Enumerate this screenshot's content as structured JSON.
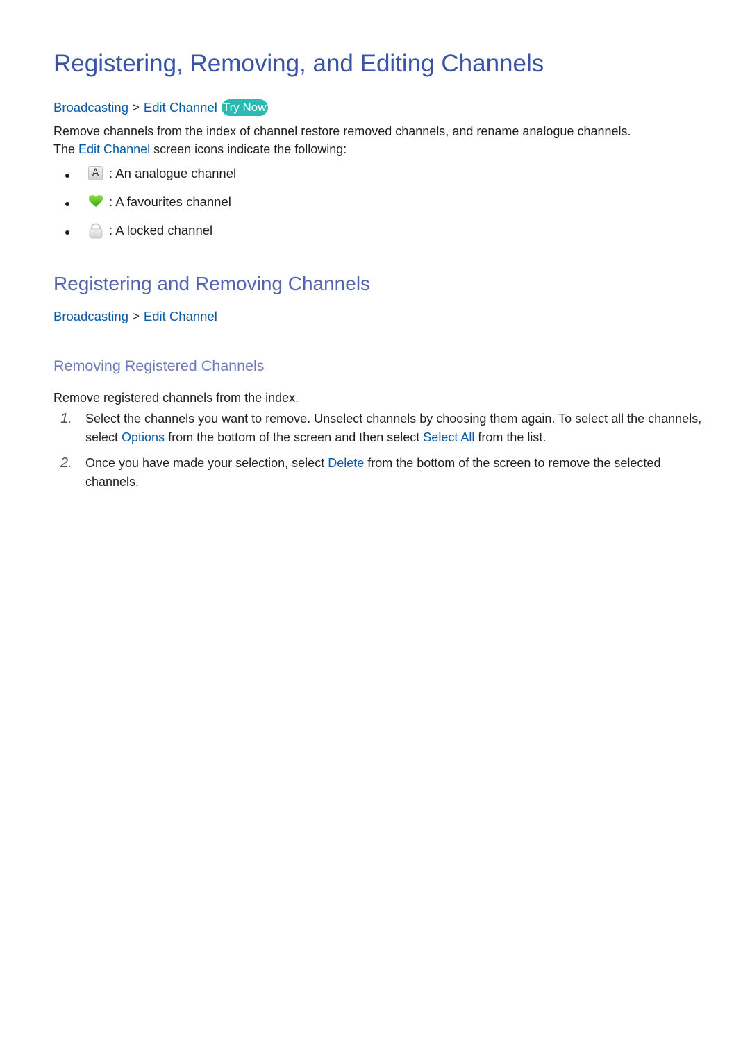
{
  "title": "Registering, Removing, and Editing Channels",
  "breadcrumb_1": {
    "items": [
      "Broadcasting",
      "Edit Channel"
    ],
    "separator": ">",
    "try_now": "Try Now"
  },
  "intro": {
    "line1": "Remove channels from the index of channel restore removed channels, and rename analogue channels.",
    "line2_prefix": "The ",
    "line2_link": "Edit Channel",
    "line2_suffix": " screen icons indicate the following:"
  },
  "icon_legend": [
    {
      "icon": "analogue-icon",
      "glyph": "A",
      "text": ": An analogue channel"
    },
    {
      "icon": "heart-icon",
      "text": ": A favourites channel"
    },
    {
      "icon": "lock-icon",
      "text": ": A locked channel"
    }
  ],
  "section": {
    "heading": "Registering and Removing Channels",
    "breadcrumb": {
      "items": [
        "Broadcasting",
        "Edit Channel"
      ],
      "separator": ">"
    },
    "subheading": "Removing Registered Channels",
    "intro": "Remove registered channels from the index.",
    "steps": [
      {
        "num": "1.",
        "parts": [
          {
            "text": "Select the channels you want to remove. Unselect channels by choosing them again. To select all the channels, select ",
            "link": false
          },
          {
            "text": "Options",
            "link": true
          },
          {
            "text": " from the bottom of the screen and then select ",
            "link": false
          },
          {
            "text": "Select All",
            "link": true
          },
          {
            "text": " from the list.",
            "link": false
          }
        ]
      },
      {
        "num": "2.",
        "parts": [
          {
            "text": "Once you have made your selection, select ",
            "link": false
          },
          {
            "text": "Delete",
            "link": true
          },
          {
            "text": " from the bottom of the screen to remove the selected channels.",
            "link": false
          }
        ]
      }
    ]
  },
  "colors": {
    "title": "#3a53a4",
    "heading2": "#5563b3",
    "heading3": "#6f7ab8",
    "link": "#0a5aa4",
    "try_now_bg": "#2bb9b4",
    "body_text": "#231f20"
  }
}
